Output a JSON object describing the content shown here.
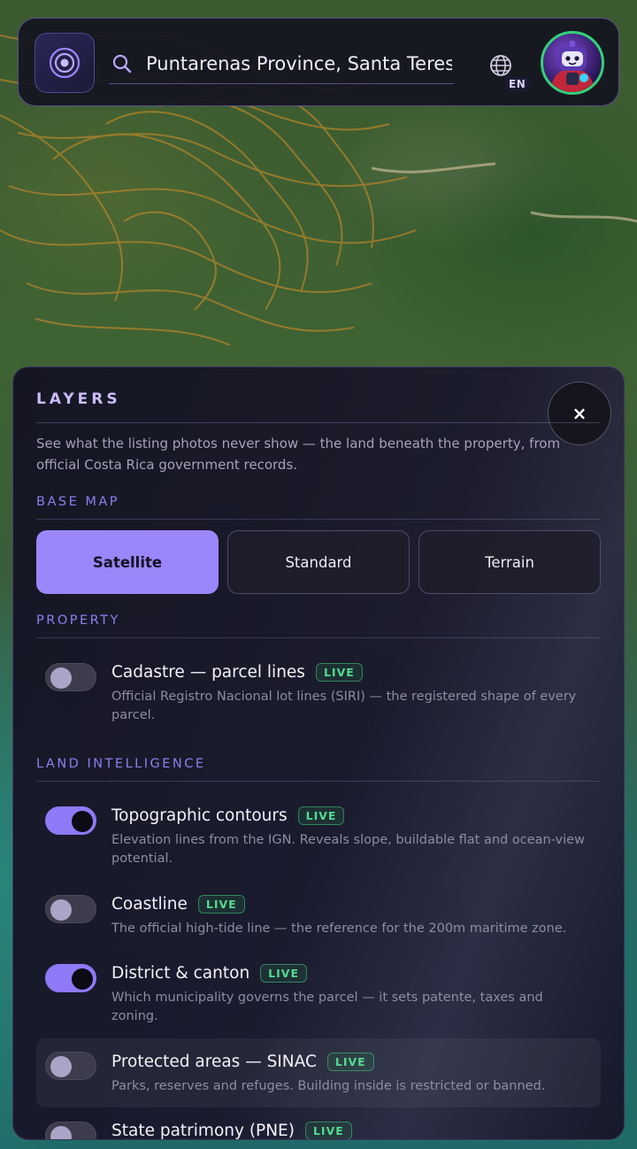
{
  "header": {
    "search_value": "Puntarenas Province, Santa Teresa",
    "language_code": "EN"
  },
  "layers_panel": {
    "title": "LAYERS",
    "close_label": "×",
    "description": "See what the listing photos never show — the land beneath the property, from official Costa Rica government records.",
    "base_map": {
      "section_label": "BASE MAP",
      "options": [
        {
          "label": "Satellite",
          "selected": true
        },
        {
          "label": "Standard",
          "selected": false
        },
        {
          "label": "Terrain",
          "selected": false
        }
      ]
    },
    "property": {
      "section_label": "PROPERTY",
      "items": [
        {
          "name": "Cadastre — parcel lines",
          "badge": "LIVE",
          "enabled": false,
          "description": "Official Registro Nacional lot lines (SIRI) — the registered shape of every parcel."
        }
      ]
    },
    "land_intelligence": {
      "section_label": "LAND INTELLIGENCE",
      "items": [
        {
          "name": "Topographic contours",
          "badge": "LIVE",
          "enabled": true,
          "description": "Elevation lines from the IGN. Reveals slope, buildable flat and ocean-view potential."
        },
        {
          "name": "Coastline",
          "badge": "LIVE",
          "enabled": false,
          "description": "The official high-tide line — the reference for the 200m maritime zone."
        },
        {
          "name": "District & canton",
          "badge": "LIVE",
          "enabled": true,
          "description": "Which municipality governs the parcel — it sets patente, taxes and zoning."
        },
        {
          "name": "Protected areas — SINAC",
          "badge": "LIVE",
          "enabled": false,
          "description": "Parks, reserves and refuges. Building inside is restricted or banned."
        },
        {
          "name": "State patrimony (PNE)",
          "badge": "LIVE",
          "enabled": false,
          "description": ""
        }
      ]
    }
  },
  "colors": {
    "accent": "#9b86fb",
    "live_badge": "#55d98f",
    "avatar_ring": "#33d17a"
  }
}
